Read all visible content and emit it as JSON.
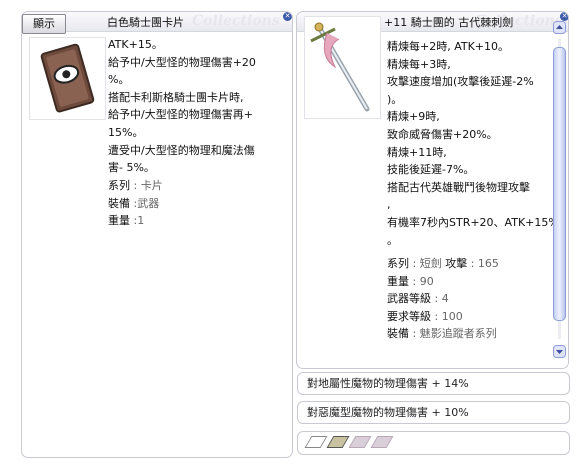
{
  "card_panel": {
    "display_button": "顯示",
    "watermark": "Collections",
    "title": "白色騎士團卡片",
    "lines": [
      "ATK+15。",
      "給予中/大型怪的物理傷害+20",
      "%。",
      "搭配卡利斯格騎士團卡片時,",
      "給予中/大型怪的物理傷害再+",
      "15%。",
      "遭受中/大型怪的物理和魔法傷",
      "害- 5%。"
    ],
    "props": [
      {
        "label": "系列",
        "sep": " : ",
        "value": "卡片"
      },
      {
        "label": "裝備",
        "sep": " :",
        "value": "武器"
      },
      {
        "label": "重量",
        "sep": " :",
        "value": "1"
      }
    ]
  },
  "weapon_panel": {
    "watermark": "Collections",
    "title": "+11 騎士團的 古代棘刺劍",
    "lines": [
      "精煉每+2時, ATK+10。",
      "精煉每+3時,",
      "攻擊速度增加(攻擊後延遲-2%",
      ")。",
      "精煉+9時,",
      "致命威脅傷害+20%。",
      "精煉+11時,",
      "技能後延遲-7%。",
      "搭配古代英雄戰鬥後物理攻擊",
      ",",
      "有機率7秒內STR+20、ATK+15%",
      "。"
    ],
    "props": [
      {
        "label": "系列",
        "value": "短劍",
        "extra_label": "攻擊",
        "extra_value": "165"
      },
      {
        "label": "重量",
        "value": "90"
      },
      {
        "label": "武器等級",
        "value": "4"
      },
      {
        "label": "要求等級",
        "value": "100"
      },
      {
        "label": "裝備",
        "value": "魅影追蹤者系列"
      }
    ]
  },
  "options": [
    "對地屬性魔物的物理傷害 + 14%",
    "對惡魔型魔物的物理傷害 +  10%"
  ],
  "slots": [
    "empty-slot",
    "card-slot",
    "empty-slot",
    "empty-slot"
  ]
}
